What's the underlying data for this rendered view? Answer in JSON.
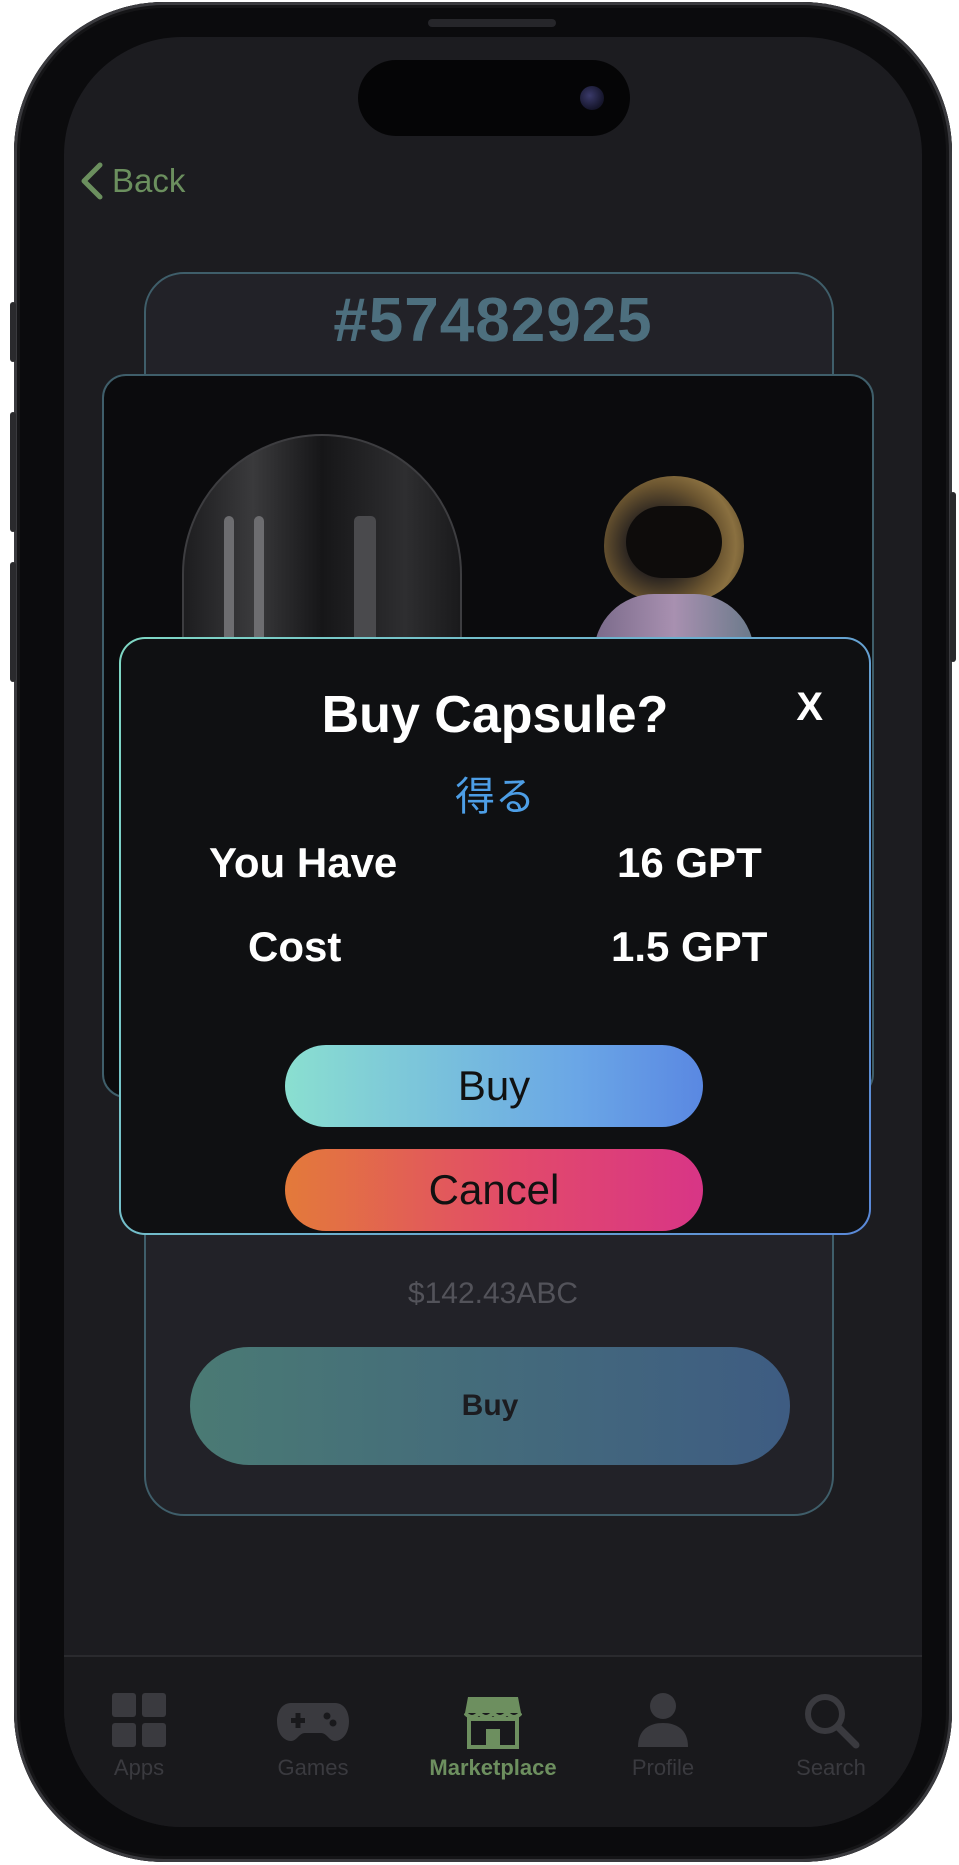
{
  "nav": {
    "back_label": "Back"
  },
  "item": {
    "id": "#57482925",
    "price": "$142.43ABC",
    "buy_label": "Buy"
  },
  "modal": {
    "title": "Buy Capsule?",
    "subtitle": "得る",
    "close_label": "X",
    "rows": [
      {
        "label": "You Have",
        "value": "16 GPT"
      },
      {
        "label": "Cost",
        "value": "1.5 GPT"
      }
    ],
    "buy_label": "Buy",
    "cancel_label": "Cancel"
  },
  "tabbar": {
    "active": "Marketplace",
    "tabs": [
      {
        "label": "Apps",
        "icon": "grid-icon"
      },
      {
        "label": "Games",
        "icon": "gamepad-icon"
      },
      {
        "label": "Marketplace",
        "icon": "storefront-icon"
      },
      {
        "label": "Profile",
        "icon": "person-icon"
      },
      {
        "label": "Search",
        "icon": "search-icon"
      }
    ]
  },
  "colors": {
    "accent_green": "#6b8f5e",
    "subtitle_blue": "#4d9ee6",
    "modal_border": "#7fd8c4",
    "buy_gradient": [
      "#8adfd0",
      "#5a88e2"
    ],
    "cancel_gradient": [
      "#e37a3a",
      "#d83586"
    ]
  }
}
